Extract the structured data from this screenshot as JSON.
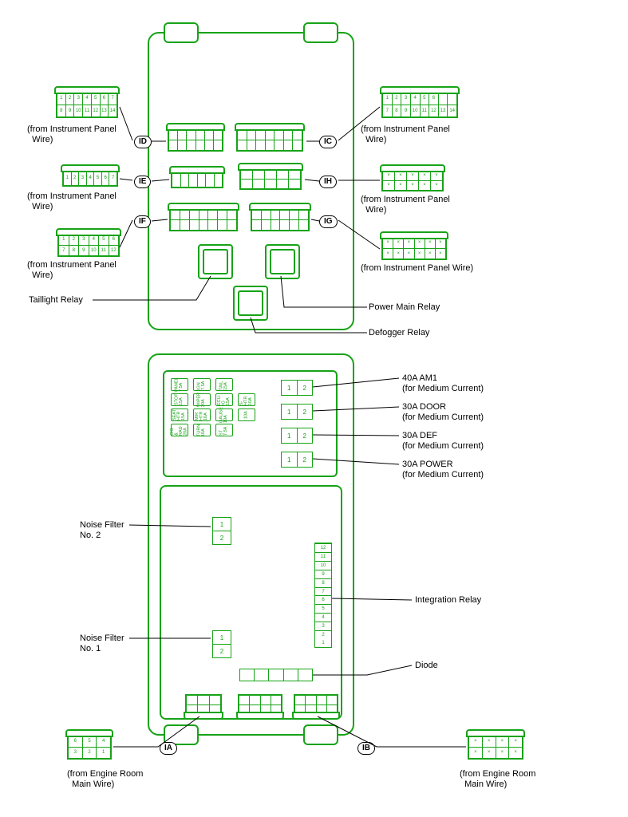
{
  "ids": {
    "ia": "IA",
    "ib": "IB",
    "ic": "IC",
    "id": "ID",
    "ie": "IE",
    "if": "IF",
    "ig": "IG",
    "ih": "IH"
  },
  "labels": {
    "ipw_tl": "(from Instrument Panel\n  Wire)",
    "ipw_ml": "(from Instrument Panel\n  Wire)",
    "ipw_bl": "(from Instrument Panel\n  Wire)",
    "ipw_tr": "(from Instrument Panel\n  Wire)",
    "ipw_mr": "(from Instrument Panel\n  Wire)",
    "ipw_br": "(from Instrument Panel Wire)",
    "taillight_relay": "Taillight Relay",
    "power_main_relay": "Power Main Relay",
    "defogger_relay": "Defogger Relay",
    "med_am1": "40A AM1\n(for Medium Current)",
    "med_door": "30A DOOR\n(for Medium Current)",
    "med_def": "30A DEF\n(for Medium Current)",
    "med_power": "30A POWER\n(for Medium Current)",
    "noise2": "Noise Filter\nNo. 2",
    "noise1": "Noise Filter\nNo. 1",
    "integration": "Integration Relay",
    "diode": "Diode",
    "erm_l": "(from Engine Room\n  Main Wire)",
    "erm_r": "(from Engine Room\n  Main Wire)"
  },
  "fuses_top": {
    "col1": [
      "PANEL 7.5A",
      "STOP 15A",
      "SEAT HTR 15A",
      "CIG & RAD 20A"
    ],
    "col2": [
      "IGN 7.5A",
      "WIPER 20A",
      "MIR HTR 10A",
      "TURN 10A"
    ],
    "col3": [
      "TAIL 15A",
      "ECU-IG 15A",
      "GAUGE 10A",
      "ST 7.5A"
    ],
    "col4": [
      "",
      "S-HTR 10A",
      "10A",
      ""
    ]
  },
  "medium_fuse_nums": [
    "1",
    "2"
  ],
  "twoslot_nums": [
    "1",
    "2"
  ],
  "integration_nums": [
    "1",
    "2",
    "3",
    "4",
    "5",
    "6",
    "7",
    "8",
    "9",
    "10",
    "11",
    "12"
  ]
}
